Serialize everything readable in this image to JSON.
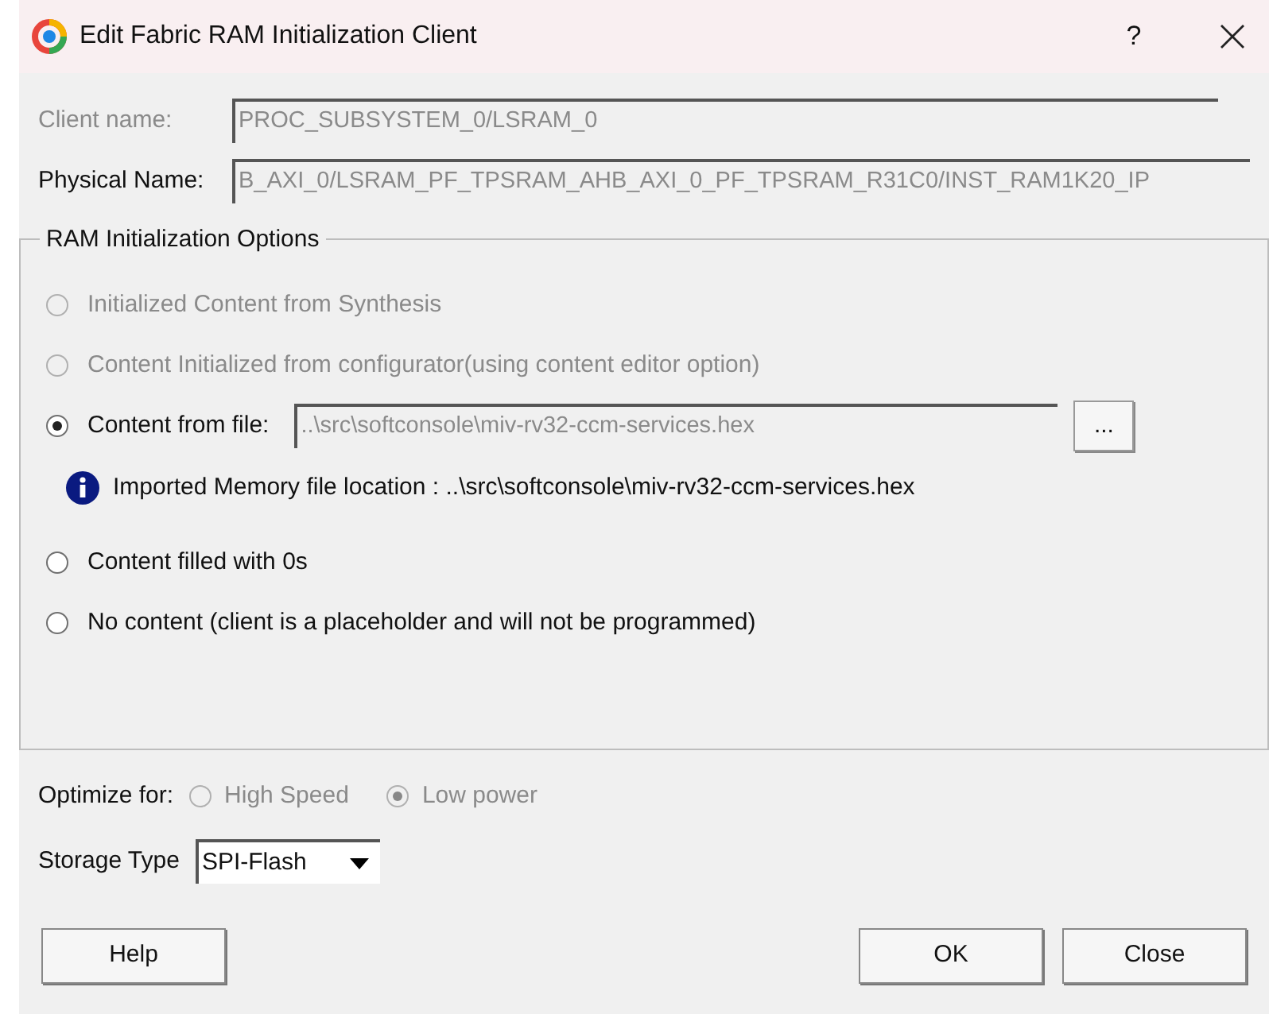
{
  "window": {
    "title": "Edit Fabric RAM Initialization Client",
    "help_button": "?"
  },
  "fields": [
    {
      "label": "Client name:",
      "value": "PROC_SUBSYSTEM_0/LSRAM_0",
      "disabled": true
    },
    {
      "label": "Physical Name:",
      "value": "B_AXI_0/LSRAM_PF_TPSRAM_AHB_AXI_0_PF_TPSRAM_R31C0/INST_RAM1K20_IP",
      "disabled": false
    }
  ],
  "ram_options": {
    "title": "RAM Initialization Options",
    "options": [
      {
        "kind": "plain",
        "label": "Initialized Content from Synthesis",
        "selected": false,
        "disabled": true
      },
      {
        "kind": "plain",
        "label": "Content Initialized from configurator(using content editor option)",
        "selected": false,
        "disabled": true
      },
      {
        "kind": "file",
        "label": "Content from file:",
        "selected": true,
        "disabled": false,
        "file": "..\\src\\softconsole\\miv-rv32-ccm-services.hex",
        "browse": "..."
      },
      {
        "kind": "info",
        "label": "Imported Memory file location : ..\\src\\softconsole\\miv-rv32-ccm-services.hex"
      },
      {
        "kind": "plain",
        "label": "Content filled with 0s",
        "selected": false,
        "disabled": false
      },
      {
        "kind": "plain",
        "label": "No content (client is a placeholder and will not be programmed)",
        "selected": false,
        "disabled": false
      }
    ]
  },
  "optimize": {
    "label": "Optimize for:",
    "options": [
      {
        "label": "High Speed",
        "selected": false,
        "disabled": true
      },
      {
        "label": "Low power",
        "selected": true,
        "disabled": true
      }
    ]
  },
  "storage": {
    "label": "Storage Type",
    "value": "SPI-Flash"
  },
  "buttons": [
    {
      "label": "Help"
    },
    {
      "label": "OK"
    },
    {
      "label": "Close"
    }
  ]
}
